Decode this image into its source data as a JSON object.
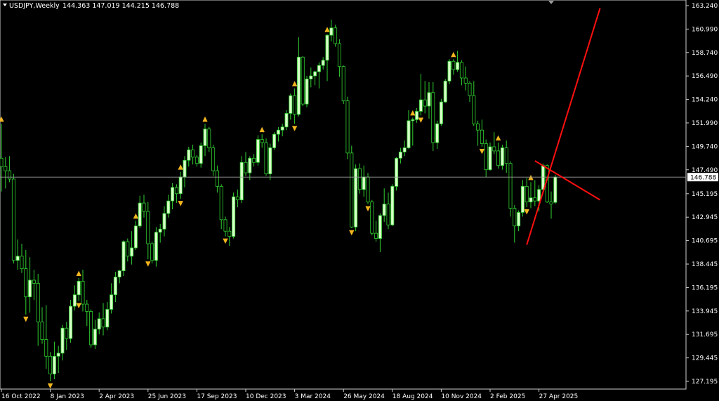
{
  "header": {
    "symbol": "USDJPY,Weekly",
    "ohlc": "144.363 147.019 144.215 146.788"
  },
  "colors": {
    "background": "#000000",
    "frame": "#cfcfcf",
    "candle_up_body": "#d8ffc8",
    "candle_down_body": "#000000",
    "candle_outline": "#2fd02f",
    "fractal": "#f2b51f",
    "trendline": "#ff1010",
    "price_line": "#a0a0a0",
    "price_label_bg": "#ffffff",
    "price_label_text": "#000000"
  },
  "chart_data": {
    "type": "candlestick",
    "symbol": "USDJPY",
    "timeframe": "Weekly",
    "last_price": 146.788,
    "last_price_label": "146.788",
    "y_ticks": [
      "163.240",
      "160.990",
      "158.740",
      "156.490",
      "154.240",
      "151.990",
      "149.740",
      "147.490",
      "145.195",
      "142.945",
      "140.695",
      "138.445",
      "136.195",
      "133.945",
      "131.695",
      "129.445",
      "127.195"
    ],
    "ylim": [
      126.5,
      163.6
    ],
    "x_ticks": [
      "16 Oct 2022",
      "8 Jan 2023",
      "2 Apr 2023",
      "25 Jun 2023",
      "17 Sep 2023",
      "10 Dec 2023",
      "3 Mar 2024",
      "26 May 2024",
      "18 Aug 2024",
      "10 Nov 2024",
      "2 Feb 2025",
      "27 Apr 2025"
    ],
    "x_tick_bar_index": [
      0,
      12,
      24,
      36,
      48,
      60,
      72,
      84,
      96,
      108,
      120,
      132
    ],
    "candles": [
      [
        148.6,
        151.9,
        145.4,
        147.8
      ],
      [
        147.8,
        148.7,
        145.7,
        147.4
      ],
      [
        147.4,
        148.8,
        146.3,
        146.6
      ],
      [
        146.6,
        147.1,
        138.5,
        138.8
      ],
      [
        138.8,
        140.8,
        137.9,
        139.2
      ],
      [
        139.2,
        140.4,
        137.6,
        138.0
      ],
      [
        138.0,
        139.8,
        133.6,
        135.3
      ],
      [
        135.3,
        139.1,
        133.8,
        136.9
      ],
      [
        136.9,
        137.9,
        135.0,
        136.6
      ],
      [
        136.6,
        137.5,
        130.6,
        132.9
      ],
      [
        132.9,
        134.3,
        130.8,
        131.2
      ],
      [
        131.2,
        134.5,
        128.4,
        129.6
      ],
      [
        129.6,
        130.0,
        127.2,
        127.9
      ],
      [
        127.9,
        131.0,
        127.4,
        129.6
      ],
      [
        129.6,
        130.6,
        128.0,
        129.9
      ],
      [
        129.9,
        132.6,
        129.2,
        132.3
      ],
      [
        132.3,
        132.9,
        130.2,
        131.3
      ],
      [
        131.3,
        135.0,
        130.9,
        134.4
      ],
      [
        134.4,
        136.4,
        134.0,
        135.5
      ],
      [
        135.5,
        137.1,
        134.9,
        136.8
      ],
      [
        136.8,
        137.9,
        133.9,
        134.6
      ],
      [
        134.6,
        135.0,
        132.5,
        133.9
      ],
      [
        133.9,
        134.1,
        130.4,
        130.7
      ],
      [
        130.7,
        133.1,
        130.3,
        132.2
      ],
      [
        132.2,
        133.8,
        131.7,
        133.2
      ],
      [
        133.2,
        134.7,
        131.6,
        132.4
      ],
      [
        132.4,
        134.8,
        132.1,
        134.1
      ],
      [
        134.1,
        136.6,
        133.7,
        135.5
      ],
      [
        135.5,
        137.7,
        134.8,
        137.2
      ],
      [
        137.2,
        137.9,
        136.6,
        137.8
      ],
      [
        137.8,
        140.7,
        137.3,
        140.6
      ],
      [
        140.6,
        140.9,
        138.7,
        139.2
      ],
      [
        139.2,
        141.6,
        138.4,
        140.0
      ],
      [
        140.0,
        142.6,
        139.8,
        142.1
      ],
      [
        142.1,
        145.0,
        141.9,
        144.3
      ],
      [
        144.3,
        145.1,
        142.9,
        143.5
      ],
      [
        143.5,
        144.4,
        138.9,
        140.4
      ],
      [
        140.4,
        140.6,
        138.5,
        138.8
      ],
      [
        138.8,
        142.0,
        138.2,
        141.5
      ],
      [
        141.5,
        142.3,
        140.5,
        141.8
      ],
      [
        141.8,
        144.0,
        141.1,
        143.3
      ],
      [
        143.3,
        145.1,
        142.9,
        144.5
      ],
      [
        144.5,
        146.2,
        143.7,
        145.8
      ],
      [
        145.8,
        146.1,
        144.3,
        145.2
      ],
      [
        145.2,
        147.3,
        144.7,
        146.8
      ],
      [
        146.8,
        148.8,
        145.8,
        148.4
      ],
      [
        148.4,
        149.7,
        147.8,
        149.4
      ],
      [
        149.4,
        149.9,
        148.0,
        148.7
      ],
      [
        148.7,
        148.9,
        147.8,
        148.1
      ],
      [
        148.1,
        150.1,
        147.7,
        149.8
      ],
      [
        149.8,
        151.9,
        148.8,
        151.4
      ],
      [
        151.4,
        151.6,
        149.2,
        149.6
      ],
      [
        149.6,
        149.9,
        146.9,
        147.4
      ],
      [
        147.4,
        147.9,
        145.3,
        145.9
      ],
      [
        145.9,
        146.1,
        141.8,
        142.7
      ],
      [
        142.7,
        143.0,
        141.1,
        141.6
      ],
      [
        141.6,
        142.0,
        140.2,
        141.1
      ],
      [
        141.1,
        145.3,
        140.9,
        144.9
      ],
      [
        144.9,
        145.6,
        143.9,
        144.6
      ],
      [
        144.6,
        148.8,
        144.3,
        148.2
      ],
      [
        148.2,
        149.2,
        146.9,
        147.2
      ],
      [
        147.2,
        148.8,
        146.5,
        148.6
      ],
      [
        148.6,
        149.0,
        147.8,
        148.2
      ],
      [
        148.2,
        150.8,
        147.9,
        150.4
      ],
      [
        150.4,
        150.9,
        149.6,
        150.1
      ],
      [
        150.1,
        150.5,
        146.9,
        147.1
      ],
      [
        147.1,
        150.0,
        146.5,
        149.6
      ],
      [
        149.6,
        151.1,
        149.4,
        150.9
      ],
      [
        150.9,
        151.6,
        150.2,
        151.3
      ],
      [
        151.3,
        151.9,
        150.7,
        151.6
      ],
      [
        151.6,
        153.2,
        151.3,
        152.9
      ],
      [
        152.9,
        154.8,
        152.3,
        154.6
      ],
      [
        154.6,
        155.3,
        151.9,
        152.8
      ],
      [
        152.8,
        160.2,
        152.6,
        158.3
      ],
      [
        158.3,
        158.4,
        153.6,
        153.8
      ],
      [
        153.8,
        156.5,
        153.5,
        156.2
      ],
      [
        156.2,
        157.3,
        155.4,
        156.5
      ],
      [
        156.5,
        157.0,
        155.6,
        156.9
      ],
      [
        156.9,
        157.8,
        155.3,
        157.5
      ],
      [
        157.5,
        158.3,
        157.1,
        158.0
      ],
      [
        158.0,
        160.5,
        156.0,
        160.4
      ],
      [
        160.4,
        161.9,
        159.8,
        161.1
      ],
      [
        161.1,
        161.4,
        159.3,
        159.6
      ],
      [
        159.6,
        160.0,
        156.4,
        157.4
      ],
      [
        157.4,
        157.5,
        153.8,
        154.1
      ],
      [
        154.1,
        154.5,
        148.5,
        149.1
      ],
      [
        149.1,
        149.8,
        141.9,
        142.0
      ],
      [
        142.0,
        148.0,
        141.6,
        147.6
      ],
      [
        147.6,
        148.1,
        145.2,
        145.6
      ],
      [
        145.6,
        147.9,
        144.9,
        146.8
      ],
      [
        146.8,
        147.2,
        144.2,
        144.4
      ],
      [
        144.4,
        144.6,
        141.2,
        141.4
      ],
      [
        141.4,
        142.6,
        140.6,
        140.9
      ],
      [
        140.9,
        143.3,
        139.6,
        143.1
      ],
      [
        143.1,
        145.7,
        142.5,
        144.2
      ],
      [
        144.2,
        145.3,
        141.8,
        142.2
      ],
      [
        142.2,
        146.1,
        142.1,
        145.9
      ],
      [
        145.9,
        148.7,
        145.5,
        148.6
      ],
      [
        148.6,
        149.6,
        148.1,
        149.2
      ],
      [
        149.2,
        150.3,
        148.8,
        149.6
      ],
      [
        149.6,
        153.2,
        149.5,
        152.2
      ],
      [
        152.2,
        152.5,
        149.8,
        152.3
      ],
      [
        152.3,
        153.4,
        152.0,
        153.1
      ],
      [
        153.1,
        156.7,
        152.7,
        154.2
      ],
      [
        154.2,
        156.0,
        152.9,
        153.6
      ],
      [
        153.6,
        155.9,
        152.4,
        154.9
      ],
      [
        154.9,
        155.9,
        149.3,
        150.1
      ],
      [
        150.1,
        152.2,
        149.5,
        151.9
      ],
      [
        151.9,
        154.3,
        151.7,
        154.0
      ],
      [
        154.0,
        156.2,
        153.9,
        156.0
      ],
      [
        156.0,
        158.1,
        155.7,
        157.9
      ],
      [
        157.9,
        158.1,
        156.6,
        157.1
      ],
      [
        157.1,
        158.9,
        156.9,
        157.8
      ],
      [
        157.8,
        158.0,
        155.6,
        156.3
      ],
      [
        156.3,
        157.4,
        155.1,
        155.8
      ],
      [
        155.8,
        156.0,
        154.0,
        154.6
      ],
      [
        154.6,
        156.0,
        151.7,
        151.9
      ],
      [
        151.9,
        152.2,
        149.8,
        151.3
      ],
      [
        151.3,
        152.3,
        149.7,
        150.0
      ],
      [
        150.0,
        150.4,
        146.8,
        147.5
      ],
      [
        147.5,
        150.1,
        147.4,
        149.7
      ],
      [
        149.7,
        151.1,
        149.0,
        149.3
      ],
      [
        149.3,
        150.1,
        147.6,
        147.9
      ],
      [
        147.9,
        149.9,
        147.5,
        149.6
      ],
      [
        149.6,
        150.3,
        147.2,
        148.1
      ],
      [
        148.1,
        148.3,
        143.0,
        143.8
      ],
      [
        143.8,
        144.1,
        140.5,
        142.1
      ],
      [
        142.1,
        143.6,
        141.6,
        143.4
      ],
      [
        143.4,
        146.5,
        143.0,
        145.9
      ],
      [
        145.9,
        146.7,
        143.9,
        144.4
      ],
      [
        144.4,
        146.3,
        143.8,
        144.8
      ],
      [
        144.8,
        146.5,
        144.0,
        144.5
      ],
      [
        144.5,
        146.0,
        143.5,
        145.6
      ],
      [
        145.6,
        148.1,
        145.2,
        147.9
      ],
      [
        147.9,
        148.0,
        144.3,
        144.4
      ],
      [
        144.4,
        145.4,
        142.8,
        144.2
      ],
      [
        144.363,
        147.019,
        144.215,
        146.788
      ]
    ],
    "fractals_up": [
      0,
      19,
      33,
      44,
      50,
      64,
      72,
      80,
      101,
      111,
      122,
      130
    ],
    "fractals_down": [
      6,
      12,
      19,
      36,
      44,
      55,
      72,
      86,
      90,
      103,
      118,
      129
    ],
    "trendlines": [
      {
        "from": [
          129,
          140.3
        ],
        "to": [
          147,
          163.0
        ]
      },
      {
        "from": [
          131,
          148.35
        ],
        "to": [
          147,
          144.6
        ]
      }
    ]
  }
}
